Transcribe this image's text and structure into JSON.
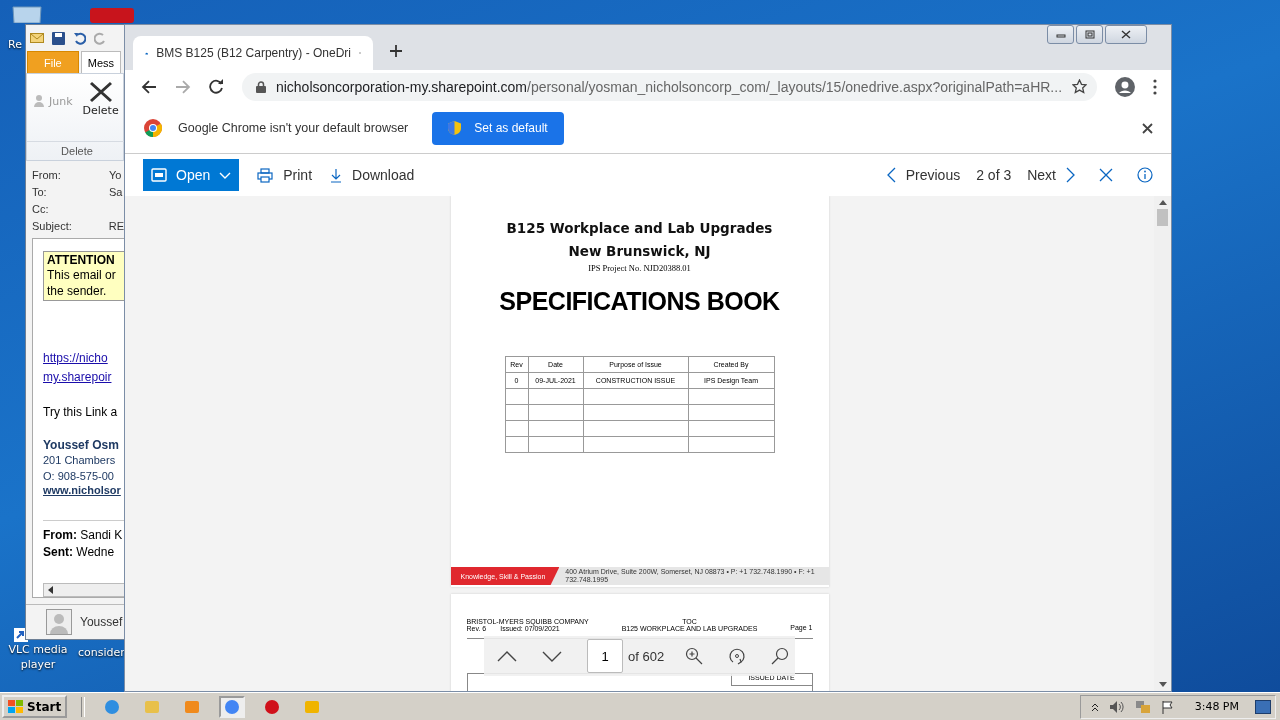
{
  "desktop": {
    "icons": [
      {
        "label": "Re",
        "kind": "bin"
      },
      {
        "label": "VLC media player",
        "kind": "vlc"
      },
      {
        "label": "consider",
        "kind": "doc"
      }
    ]
  },
  "outlook": {
    "tabs": [
      {
        "label": "File",
        "selected": false
      },
      {
        "label": "Mess",
        "selected": true
      }
    ],
    "junk": "Junk",
    "delete": "Delete",
    "group": "Delete",
    "headers": [
      {
        "label": "From:",
        "value": "Yo"
      },
      {
        "label": "To:",
        "value": "Sa"
      },
      {
        "label": "Cc:"
      },
      {
        "label": "Subject:",
        "value": "RE"
      }
    ],
    "attention": {
      "title": "ATTENTION",
      "lines": [
        "This email or",
        "the sender."
      ]
    },
    "link_lines": [
      "https://nicho",
      "my.sharepoir"
    ],
    "body": "Try this Link a",
    "signature": {
      "name": "Youssef Osm",
      "address": "201 Chambers",
      "phone": "O: 908-575-00",
      "website": "www.nicholsor"
    },
    "quoted": [
      {
        "label": "From:",
        "value": "Sandi K"
      },
      {
        "label": "Sent:",
        "value": "Wedne"
      }
    ],
    "contact": "Youssef"
  },
  "browser": {
    "tabs": [
      {
        "title": "BMS B125 (B12 Carpentry) - OneDri",
        "selected": true
      }
    ],
    "url": {
      "host": "nicholsoncorporation-my.sharepoint.com",
      "path": "/personal/yosman_nicholsoncorp_com/_layouts/15/onedrive.aspx?originalPath=aHR..."
    },
    "infobar": {
      "message": "Google Chrome isn't your default browser",
      "button": "Set as default"
    },
    "commands": {
      "open": "Open",
      "print": "Print",
      "download": "Download",
      "previous": "Previous",
      "position": "2 of 3",
      "next": "Next"
    }
  },
  "document": {
    "title": "B125 Workplace and Lab Upgrades",
    "location": "New Brunswick, NJ",
    "project": "IPS Project No. NJD20388.01",
    "heading": "SPECIFICATIONS BOOK",
    "revisions": {
      "columns": [
        "Rev",
        "Date",
        "Purpose of Issue",
        "Created By"
      ],
      "rows": [
        [
          "0",
          "09-JUL-2021",
          "CONSTRUCTION ISSUE",
          "IPS Design Team"
        ],
        [
          "",
          "",
          "",
          ""
        ],
        [
          "",
          "",
          "",
          ""
        ],
        [
          "",
          "",
          "",
          ""
        ],
        [
          "",
          "",
          "",
          ""
        ]
      ]
    },
    "footer": {
      "tagline": "Knowledge, Skill & Passion",
      "address": "400 Atrium Drive, Suite 200W, Somerset, NJ 08873 • P: +1 732.748.1990 • F: +1 732.748.1995"
    },
    "page2": {
      "company": "BRISTOL-MYERS SQUIBB COMPANY",
      "rev": "Rev. 6",
      "issued": "Issued:  07/09/2021",
      "section": "TOC",
      "project": "B125 WORKPLACE AND LAB UPGRADES",
      "page": "Page 1",
      "cell": "ISSUED DATE"
    }
  },
  "pdf_toolbar": {
    "page": "1",
    "total": "of 602"
  },
  "taskbar": {
    "start": "Start",
    "apps": [
      {
        "kind": "ie",
        "selected": false
      },
      {
        "kind": "folder",
        "selected": false
      },
      {
        "kind": "media",
        "selected": false
      },
      {
        "kind": "chrome",
        "selected": true
      },
      {
        "kind": "opera",
        "selected": false
      },
      {
        "kind": "outlook",
        "selected": false
      }
    ],
    "time": "3:48 PM"
  }
}
